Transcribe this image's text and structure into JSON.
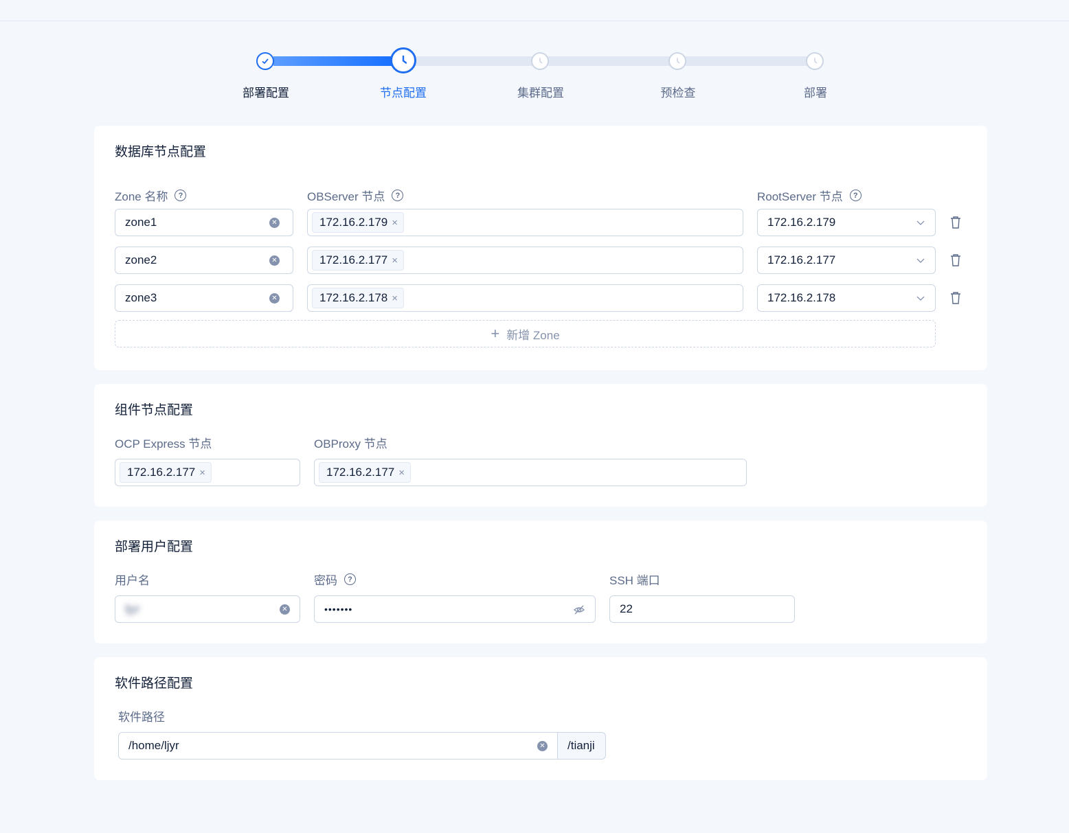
{
  "steps": [
    {
      "label": "部署配置",
      "state": "done"
    },
    {
      "label": "节点配置",
      "state": "active"
    },
    {
      "label": "集群配置",
      "state": "pending"
    },
    {
      "label": "预检查",
      "state": "pending"
    },
    {
      "label": "部署",
      "state": "pending"
    }
  ],
  "db_nodes": {
    "title": "数据库节点配置",
    "zone_label": "Zone 名称",
    "observer_label": "OBServer 节点",
    "rootserver_label": "RootServer 节点",
    "rows": [
      {
        "zone": "zone1",
        "observer": "172.16.2.179",
        "rootserver": "172.16.2.179"
      },
      {
        "zone": "zone2",
        "observer": "172.16.2.177",
        "rootserver": "172.16.2.177"
      },
      {
        "zone": "zone3",
        "observer": "172.16.2.178",
        "rootserver": "172.16.2.178"
      }
    ],
    "add_zone_label": "新增 Zone"
  },
  "component_nodes": {
    "title": "组件节点配置",
    "ocp_label": "OCP Express 节点",
    "ocp_value": "172.16.2.177",
    "obproxy_label": "OBProxy 节点",
    "obproxy_value": "172.16.2.177"
  },
  "deploy_user": {
    "title": "部署用户配置",
    "username_label": "用户名",
    "username_value": "ljyr",
    "password_label": "密码",
    "password_value": "•••••••",
    "ssh_label": "SSH 端口",
    "ssh_value": "22"
  },
  "software_path": {
    "title": "软件路径配置",
    "path_label": "软件路径",
    "path_value": "/home/ljyr",
    "path_suffix": "/tianji"
  },
  "colors": {
    "primary": "#1f6df0",
    "background": "#f4f7fc",
    "border": "#cdd6e4",
    "label": "#5c6b8a"
  }
}
